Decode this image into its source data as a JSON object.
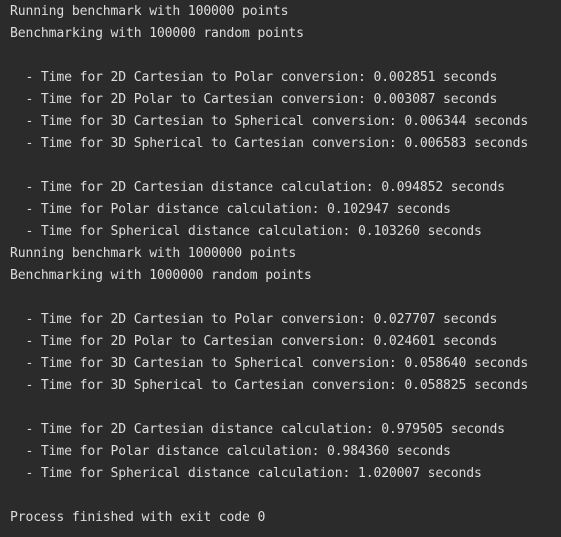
{
  "console": {
    "lines": [
      "Running benchmark with 100000 points",
      "Benchmarking with 100000 random points",
      "",
      "  - Time for 2D Cartesian to Polar conversion: 0.002851 seconds",
      "  - Time for 2D Polar to Cartesian conversion: 0.003087 seconds",
      "  - Time for 3D Cartesian to Spherical conversion: 0.006344 seconds",
      "  - Time for 3D Spherical to Cartesian conversion: 0.006583 seconds",
      "",
      "  - Time for 2D Cartesian distance calculation: 0.094852 seconds",
      "  - Time for Polar distance calculation: 0.102947 seconds",
      "  - Time for Spherical distance calculation: 0.103260 seconds",
      "Running benchmark with 1000000 points",
      "Benchmarking with 1000000 random points",
      "",
      "  - Time for 2D Cartesian to Polar conversion: 0.027707 seconds",
      "  - Time for 2D Polar to Cartesian conversion: 0.024601 seconds",
      "  - Time for 3D Cartesian to Spherical conversion: 0.058640 seconds",
      "  - Time for 3D Spherical to Cartesian conversion: 0.058825 seconds",
      "",
      "  - Time for 2D Cartesian distance calculation: 0.979505 seconds",
      "  - Time for Polar distance calculation: 0.984360 seconds",
      "  - Time for Spherical distance calculation: 1.020007 seconds",
      "",
      "Process finished with exit code 0"
    ]
  },
  "colors": {
    "background": "#2b2b2b",
    "text": "#dcdcdc"
  }
}
